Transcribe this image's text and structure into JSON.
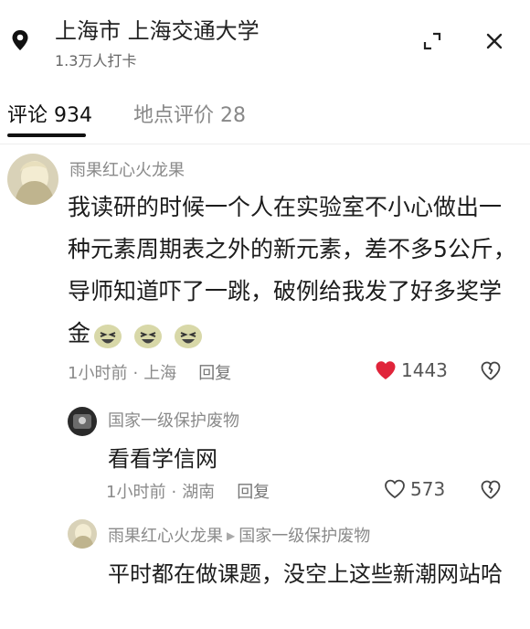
{
  "header": {
    "title": "上海市  上海交通大学",
    "checkins": "1.3万人打卡"
  },
  "tabs": [
    {
      "label": "评论 934",
      "active": true
    },
    {
      "label": "地点评价 28",
      "active": false
    }
  ],
  "comments": [
    {
      "user": "雨果红心火龙果",
      "text": "我读研的时候一个人在实验室不小心做出一种元素周期表之外的新元素，差不多5公斤，导师知道吓了一跳，破例给我发了好多奖学金",
      "time": "1小时前",
      "location": "上海",
      "reply_label": "回复",
      "likes": "1443",
      "liked": true
    },
    {
      "user": "国家一级保护废物",
      "text": "看看学信网",
      "time": "1小时前",
      "location": "湖南",
      "reply_label": "回复",
      "likes": "573",
      "liked": false
    },
    {
      "user": "雨果红心火龙果",
      "reply_to": "国家一级保护废物",
      "text": "平时都在做课题，没空上这些新潮网站哈"
    }
  ],
  "icons": {
    "location": "location-pin-icon",
    "expand": "expand-icon",
    "close": "close-icon",
    "like": "heart-icon",
    "dislike": "broken-heart-icon",
    "emoji": "laughing-face-emoji"
  },
  "colors": {
    "like_active": "#e0243a",
    "meta_text": "#8a8a8a"
  }
}
